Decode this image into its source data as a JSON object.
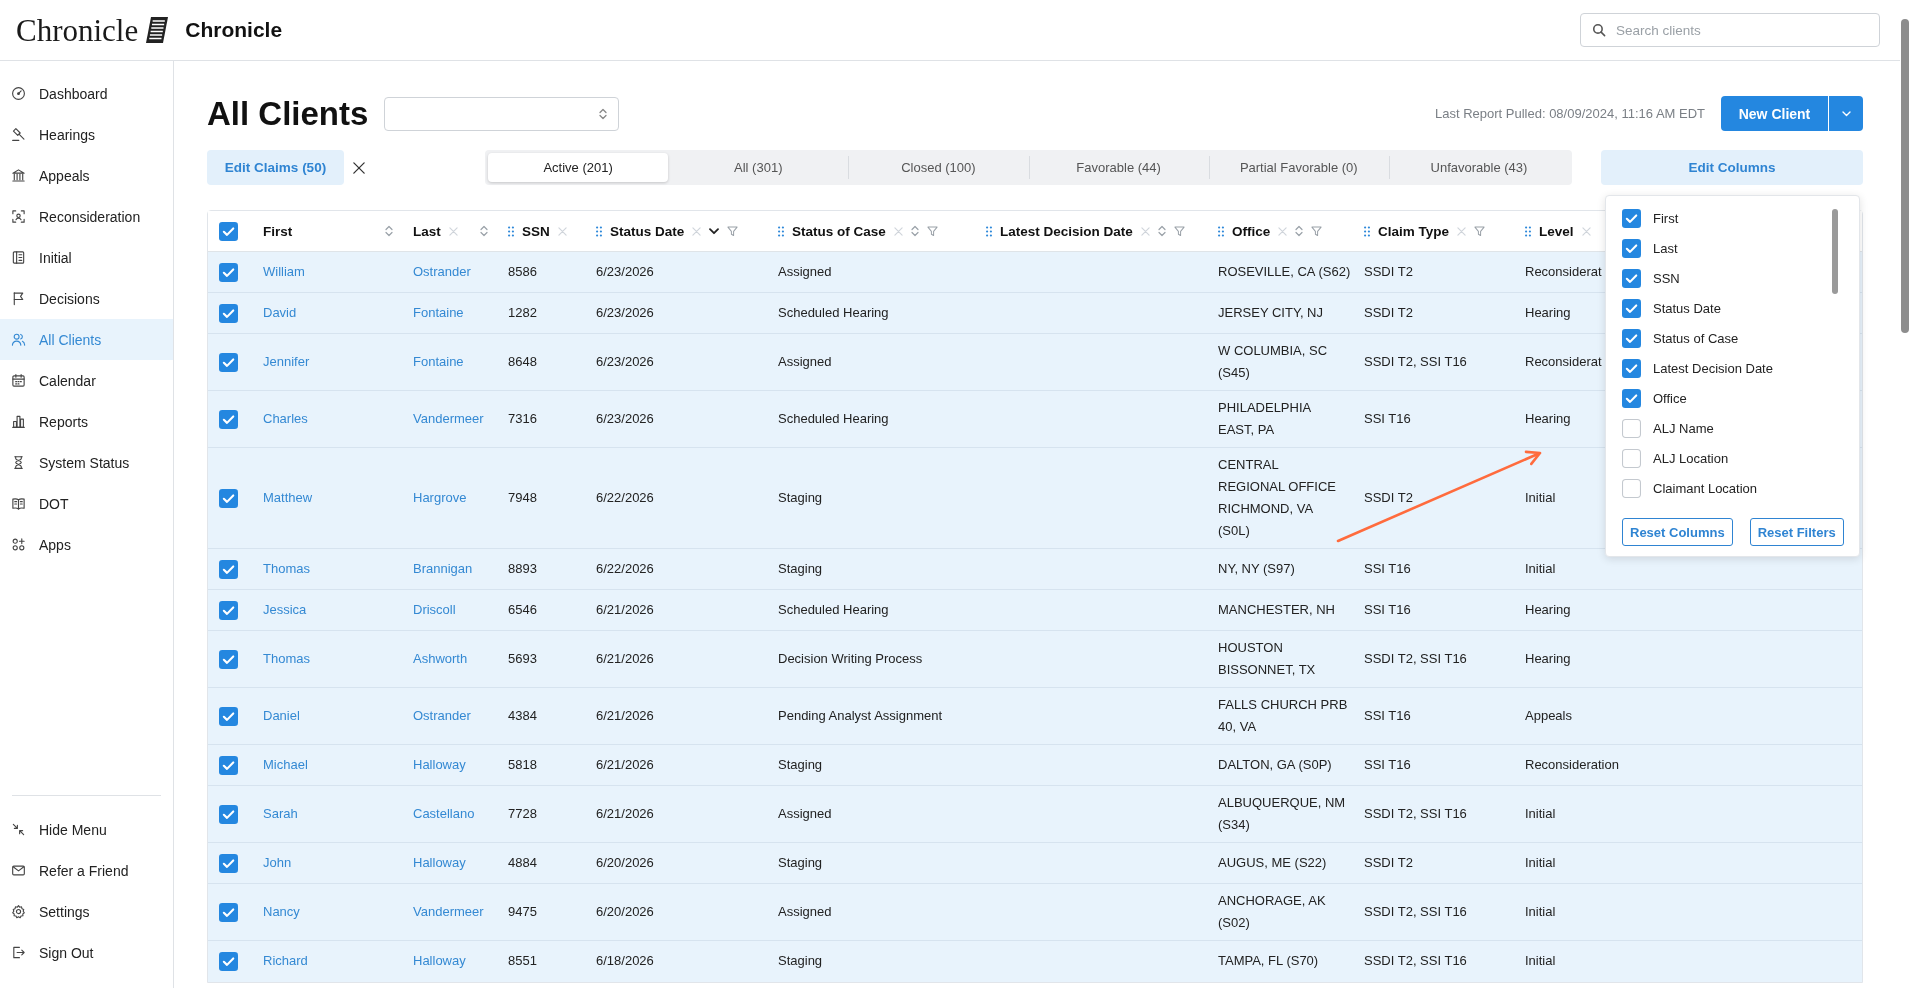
{
  "header": {
    "logo_text": "Chronicle",
    "app_name": "Chronicle",
    "search": {
      "placeholder": "Search clients"
    }
  },
  "sidebar": {
    "items": [
      {
        "label": "Dashboard",
        "selected": false
      },
      {
        "label": "Hearings",
        "selected": false
      },
      {
        "label": "Appeals",
        "selected": false
      },
      {
        "label": "Reconsideration",
        "selected": false
      },
      {
        "label": "Initial",
        "selected": false
      },
      {
        "label": "Decisions",
        "selected": false
      },
      {
        "label": "All Clients",
        "selected": true
      },
      {
        "label": "Calendar",
        "selected": false
      },
      {
        "label": "Reports",
        "selected": false
      },
      {
        "label": "System Status",
        "selected": false
      },
      {
        "label": "DOT",
        "selected": false
      },
      {
        "label": "Apps",
        "selected": false
      }
    ],
    "footer_items": [
      {
        "label": "Hide Menu"
      },
      {
        "label": "Refer a Friend"
      },
      {
        "label": "Settings"
      },
      {
        "label": "Sign Out"
      }
    ]
  },
  "page": {
    "title": "All Clients",
    "last_report": "Last Report Pulled: 08/09/2024, 11:16 AM EDT",
    "new_client_button": "New Client",
    "edit_claims_button": "Edit Claims (50)",
    "edit_columns_button": "Edit Columns"
  },
  "tabs": [
    {
      "label": "Active (201)",
      "selected": true
    },
    {
      "label": "All (301)",
      "selected": false
    },
    {
      "label": "Closed (100)",
      "selected": false
    },
    {
      "label": "Favorable (44)",
      "selected": false
    },
    {
      "label": "Partial Favorable (0)",
      "selected": false
    },
    {
      "label": "Unfavorable (43)",
      "selected": false
    }
  ],
  "table": {
    "all_selected": true,
    "columns": [
      {
        "label": "First",
        "draggable": false,
        "clearable": false,
        "sortable": true,
        "sorted": false,
        "filterable": false
      },
      {
        "label": "Last",
        "draggable": false,
        "clearable": true,
        "sortable": true,
        "sorted": false,
        "filterable": false
      },
      {
        "label": "SSN",
        "draggable": true,
        "clearable": true,
        "sortable": false,
        "filterable": false
      },
      {
        "label": "Status Date",
        "draggable": true,
        "clearable": true,
        "sortable": true,
        "sorted": true,
        "filterable": true
      },
      {
        "label": "Status of Case",
        "draggable": true,
        "clearable": true,
        "sortable": true,
        "sorted": false,
        "filterable": true
      },
      {
        "label": "Latest Decision Date",
        "draggable": true,
        "clearable": true,
        "sortable": true,
        "sorted": false,
        "filterable": true
      },
      {
        "label": "Office",
        "draggable": true,
        "clearable": true,
        "sortable": true,
        "sorted": false,
        "filterable": true
      },
      {
        "label": "Claim Type",
        "draggable": true,
        "clearable": true,
        "sortable": false,
        "filterable": true
      },
      {
        "label": "Level",
        "draggable": true,
        "clearable": true,
        "sortable": false,
        "filterable": false
      }
    ],
    "rows": [
      {
        "selected": true,
        "first": "William",
        "last": "Ostrander",
        "ssn": "8586",
        "status_date": "6/23/2026",
        "status_of_case": "Assigned",
        "office": "ROSEVILLE, CA (S62)",
        "claim_type": "SSDI T2",
        "level": "Reconsiderat"
      },
      {
        "selected": true,
        "first": "David",
        "last": "Fontaine",
        "ssn": "1282",
        "status_date": "6/23/2026",
        "status_of_case": "Scheduled Hearing",
        "office": "JERSEY CITY, NJ",
        "claim_type": "SSDI T2",
        "level": "Hearing"
      },
      {
        "selected": true,
        "first": "Jennifer",
        "last": "Fontaine",
        "ssn": "8648",
        "status_date": "6/23/2026",
        "status_of_case": "Assigned",
        "office": "W COLUMBIA, SC\n(S45)",
        "claim_type": "SSDI T2, SSI T16",
        "level": "Reconsiderat"
      },
      {
        "selected": true,
        "first": "Charles",
        "last": "Vandermeer",
        "ssn": "7316",
        "status_date": "6/23/2026",
        "status_of_case": "Scheduled Hearing",
        "office": "PHILADELPHIA\nEAST, PA",
        "claim_type": "SSI T16",
        "level": "Hearing"
      },
      {
        "selected": true,
        "first": "Matthew",
        "last": "Hargrove",
        "ssn": "7948",
        "status_date": "6/22/2026",
        "status_of_case": "Staging",
        "office": "CENTRAL\nREGIONAL OFFICE\nRICHMOND, VA\n(S0L)",
        "claim_type": "SSDI T2",
        "level": "Initial"
      },
      {
        "selected": true,
        "first": "Thomas",
        "last": "Brannigan",
        "ssn": "8893",
        "status_date": "6/22/2026",
        "status_of_case": "Staging",
        "office": "NY, NY (S97)",
        "claim_type": "SSI T16",
        "level": "Initial"
      },
      {
        "selected": true,
        "first": "Jessica",
        "last": "Driscoll",
        "ssn": "6546",
        "status_date": "6/21/2026",
        "status_of_case": "Scheduled Hearing",
        "office": "MANCHESTER, NH",
        "claim_type": "SSI T16",
        "level": "Hearing"
      },
      {
        "selected": true,
        "first": "Thomas",
        "last": "Ashworth",
        "ssn": "5693",
        "status_date": "6/21/2026",
        "status_of_case": "Decision Writing Process",
        "office": "HOUSTON\nBISSONNET, TX",
        "claim_type": "SSDI T2, SSI T16",
        "level": "Hearing"
      },
      {
        "selected": true,
        "first": "Daniel",
        "last": "Ostrander",
        "ssn": "4384",
        "status_date": "6/21/2026",
        "status_of_case": "Pending Analyst Assignment",
        "office": "FALLS CHURCH PRB\n40, VA",
        "claim_type": "SSI T16",
        "level": "Appeals"
      },
      {
        "selected": true,
        "first": "Michael",
        "last": "Halloway",
        "ssn": "5818",
        "status_date": "6/21/2026",
        "status_of_case": "Staging",
        "office": "DALTON, GA (S0P)",
        "claim_type": "SSI T16",
        "level": "Reconsideration"
      },
      {
        "selected": true,
        "first": "Sarah",
        "last": "Castellano",
        "ssn": "7728",
        "status_date": "6/21/2026",
        "status_of_case": "Assigned",
        "office": "ALBUQUERQUE, NM\n(S34)",
        "claim_type": "SSDI T2, SSI T16",
        "level": "Initial"
      },
      {
        "selected": true,
        "first": "John",
        "last": "Halloway",
        "ssn": "4884",
        "status_date": "6/20/2026",
        "status_of_case": "Staging",
        "office": "AUGUS, ME (S22)",
        "claim_type": "SSDI T2",
        "level": "Initial"
      },
      {
        "selected": true,
        "first": "Nancy",
        "last": "Vandermeer",
        "ssn": "9475",
        "status_date": "6/20/2026",
        "status_of_case": "Assigned",
        "office": "ANCHORAGE, AK\n(S02)",
        "claim_type": "SSDI T2, SSI T16",
        "level": "Initial"
      },
      {
        "selected": true,
        "first": "Richard",
        "last": "Halloway",
        "ssn": "8551",
        "status_date": "6/18/2026",
        "status_of_case": "Staging",
        "office": "TAMPA, FL (S70)",
        "claim_type": "SSDI T2, SSI T16",
        "level": "Initial"
      }
    ]
  },
  "column_menu": {
    "items": [
      {
        "label": "First",
        "checked": true
      },
      {
        "label": "Last",
        "checked": true
      },
      {
        "label": "SSN",
        "checked": true
      },
      {
        "label": "Status Date",
        "checked": true
      },
      {
        "label": "Status of Case",
        "checked": true
      },
      {
        "label": "Latest Decision Date",
        "checked": true
      },
      {
        "label": "Office",
        "checked": true
      },
      {
        "label": "ALJ Name",
        "checked": false
      },
      {
        "label": "ALJ Location",
        "checked": false
      },
      {
        "label": "Claimant Location",
        "checked": false
      }
    ],
    "buttons": [
      "Reset Columns",
      "Reset Filters"
    ]
  }
}
